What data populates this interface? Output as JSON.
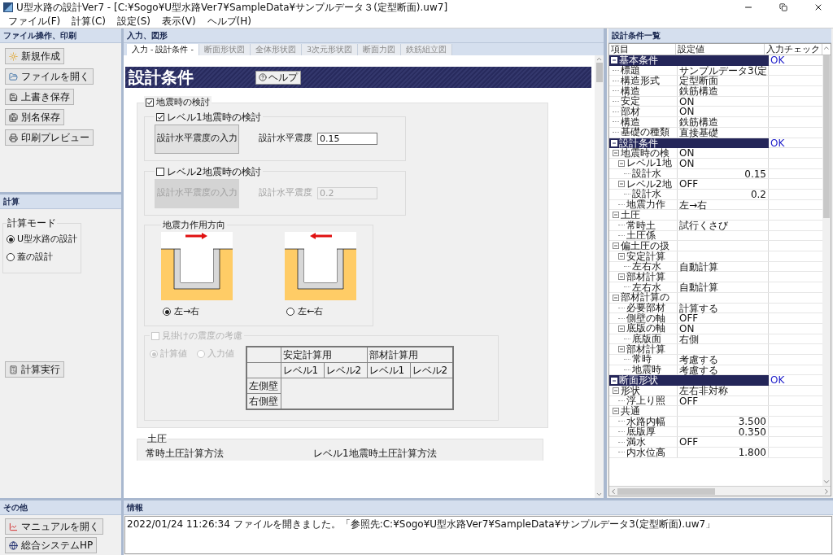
{
  "window": {
    "title": "U型水路の設計Ver7 - [C:¥Sogo¥U型水路Ver7¥SampleData¥サンプルデータ３(定型断面).uw7]"
  },
  "menu": [
    "ファイル(F)",
    "計算(C)",
    "設定(S)",
    "表示(V)",
    "ヘルプ(H)"
  ],
  "file_panel": {
    "title": "ファイル操作、印刷",
    "buttons": [
      {
        "label": "新規作成",
        "kind": "new"
      },
      {
        "label": "ファイルを開く",
        "kind": "open"
      },
      {
        "label": "上書き保存",
        "kind": "save"
      },
      {
        "label": "別名保存",
        "kind": "saveas"
      },
      {
        "label": "印刷プレビュー",
        "kind": "print"
      }
    ]
  },
  "calc_panel": {
    "title": "計算",
    "mode_title": "計算モード",
    "modes": [
      {
        "label": "U型水路の設計",
        "selected": true
      },
      {
        "label": "蓋の設計",
        "selected": false
      }
    ],
    "run_button": "計算実行"
  },
  "other_panel": {
    "title": "その他",
    "buttons": [
      {
        "label": "マニュアルを開く",
        "kind": "manual"
      },
      {
        "label": "総合システムHP",
        "kind": "web"
      }
    ]
  },
  "main": {
    "title": "入力、図形",
    "tabs": [
      {
        "label": "入力 - 設計条件 -",
        "selected": true
      },
      {
        "label": "断面形状図",
        "selected": false
      },
      {
        "label": "全体形状図",
        "selected": false
      },
      {
        "label": "3次元形状図",
        "selected": false
      },
      {
        "label": "断面力図",
        "selected": false
      },
      {
        "label": "鉄筋組立図",
        "selected": false
      }
    ],
    "banner": "設計条件",
    "help_button": "ヘルプ",
    "seismic": {
      "label": "地震時の検討",
      "checked": true,
      "levels": [
        {
          "label": "レベル1地震時の検討",
          "checked": true,
          "button": "設計水平震度の入力",
          "field_label": "設計水平震度",
          "value": "0.15"
        },
        {
          "label": "レベル2地震時の検討",
          "checked": false,
          "button": "設計水平震度の入力",
          "field_label": "設計水平震度",
          "value": "0.2"
        }
      ],
      "direction": {
        "title": "地震力作用方向",
        "options": [
          {
            "label": "左→右",
            "selected": true,
            "kind": "right"
          },
          {
            "label": "左←右",
            "selected": false,
            "kind": "left"
          }
        ]
      },
      "apparent": {
        "label": "見掛けの震度の考慮",
        "checked": false,
        "disabled": true,
        "options": [
          {
            "label": "計算値",
            "selected": true
          },
          {
            "label": "入力値",
            "selected": false
          }
        ],
        "table": {
          "groups": [
            "安定計算用",
            "部材計算用"
          ],
          "subheads": [
            "レベル1",
            "レベル2",
            "レベル1",
            "レベル2"
          ],
          "rows": [
            "左側壁",
            "右側壁"
          ]
        }
      }
    },
    "earth_pressure": {
      "title": "土圧",
      "labels": [
        "常時土圧計算方法",
        "レベル1地震時土圧計算方法"
      ]
    }
  },
  "conditions": {
    "title": "設計条件一覧",
    "columns": [
      "項目",
      "設定値",
      "入力チェック"
    ],
    "groups": [
      {
        "label": "基本条件",
        "check": "OK",
        "children": [
          {
            "label": "標題",
            "value": "サンプルデータ3(定"
          },
          {
            "label": "構造形式",
            "value": "定型断面"
          },
          {
            "label": "構造",
            "value": "鉄筋構造"
          },
          {
            "label": "安定",
            "value": "ON"
          },
          {
            "label": "部材",
            "value": "ON"
          },
          {
            "label": "構造",
            "value": "鉄筋構造"
          },
          {
            "label": "基礎の種類",
            "value": "直接基礎"
          }
        ]
      },
      {
        "label": "設計条件",
        "check": "OK",
        "children": [
          {
            "label": "地震時の検",
            "value": "ON",
            "children": [
              {
                "label": "レベル1地",
                "value": "ON",
                "children": [
                  {
                    "label": "設計水",
                    "value": "0.15",
                    "kind": "number"
                  }
                ]
              },
              {
                "label": "レベル2地",
                "value": "OFF",
                "children": [
                  {
                    "label": "設計水",
                    "value": "0.2",
                    "kind": "number"
                  }
                ]
              },
              {
                "label": "地震力作",
                "value": "左→右"
              }
            ]
          },
          {
            "label": "土圧",
            "children": [
              {
                "label": "常時土",
                "value": "試行くさび"
              },
              {
                "label": "土圧係"
              }
            ]
          },
          {
            "label": "偏土圧の扱",
            "children": [
              {
                "label": "安定計算",
                "children": [
                  {
                    "label": "左右水",
                    "value": "自動計算"
                  }
                ]
              },
              {
                "label": "部材計算",
                "children": [
                  {
                    "label": "左右水",
                    "value": "自動計算"
                  }
                ]
              }
            ]
          },
          {
            "label": "部材計算の",
            "children": [
              {
                "label": "必要部材",
                "value": "計算する"
              },
              {
                "label": "側壁の軸",
                "value": "OFF"
              },
              {
                "label": "底版の軸",
                "value": "ON",
                "children": [
                  {
                    "label": "底版面",
                    "value": "右側"
                  }
                ]
              },
              {
                "label": "部材計算",
                "children": [
                  {
                    "label": "常時",
                    "value": "考慮する"
                  },
                  {
                    "label": "地震時",
                    "value": "考慮する"
                  }
                ]
              }
            ]
          }
        ]
      },
      {
        "label": "断面形状",
        "check": "OK",
        "children": [
          {
            "label": "形状",
            "value": "左右非対称",
            "children": [
              {
                "label": "浮上り照",
                "value": "OFF"
              }
            ]
          },
          {
            "label": "共通",
            "children": [
              {
                "label": "水路内幅",
                "value": "3.500",
                "kind": "number"
              },
              {
                "label": "底版厚",
                "value": "0.350",
                "kind": "number"
              },
              {
                "label": "満水",
                "value": "OFF"
              },
              {
                "label": "内水位高",
                "value": "1.800",
                "kind": "number"
              }
            ]
          }
        ]
      }
    ]
  },
  "info": {
    "title": "情報",
    "lines": [
      "2022/01/24 11:26:34 ファイルを開きました。「参照先:C:¥Sogo¥U型水路Ver7¥SampleData¥サンプルデータ3(定型断面).uw7」"
    ]
  }
}
